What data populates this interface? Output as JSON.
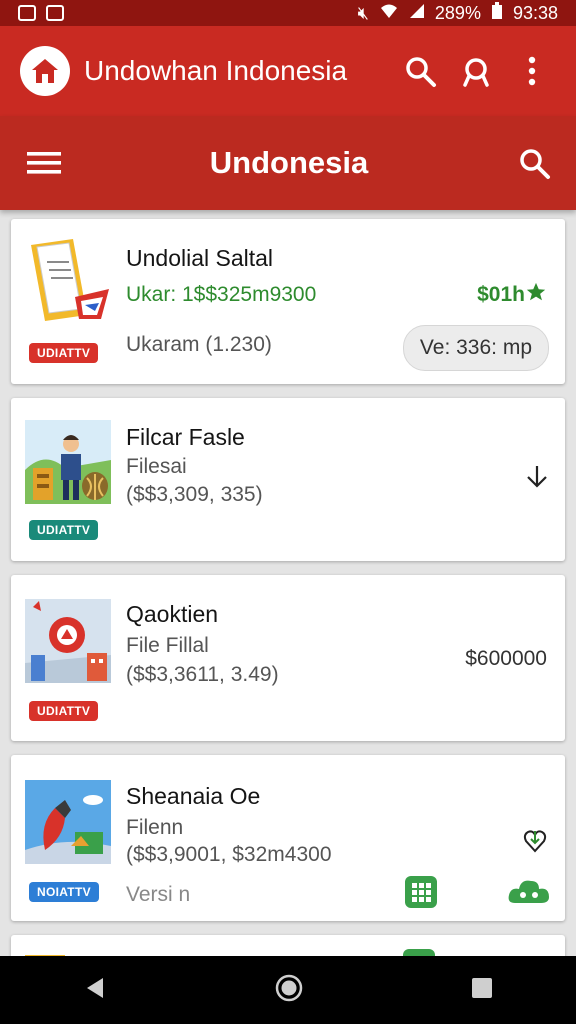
{
  "status_bar": {
    "battery": "289%",
    "time": "93:38"
  },
  "app_bar": {
    "title": "Undowhan Indonesia"
  },
  "sub_bar": {
    "title": "Undonesia"
  },
  "colors": {
    "primary": "#c92a22",
    "primary_dark": "#8f1510",
    "green": "#2e8b2e",
    "badge_red": "#d8322a",
    "badge_teal": "#1a8a7a",
    "badge_blue": "#2d7ed6"
  },
  "cards": [
    {
      "title": "Undolial Saltal",
      "line2": "Ukar: 1$$325m9300",
      "line3": "Ukaram (1.230)",
      "price": "$01h",
      "badge": "UDIATTV",
      "chip": "Ve: 336: mp",
      "icons": [
        "document-icon",
        "star-icon"
      ]
    },
    {
      "title": "Filcar Fasle",
      "line2": "Filesai",
      "line3": "($$3,309, 335)",
      "badge": "UDIATTV",
      "icons": [
        "person-icon",
        "download-arrow-icon"
      ]
    },
    {
      "title": "Qaoktien",
      "line2": "File Fillal",
      "line3": "($$3,3611, 3.49)",
      "price": "$600000",
      "badge": "UDIATTV",
      "icons": [
        "pin-map-icon"
      ]
    },
    {
      "title": "Sheanaia Oe",
      "line2": "Filenn",
      "line3": "($$3,9001, $32m4300",
      "line4": "Versi n",
      "badge": "NOIATTV",
      "icons": [
        "rocket-icon",
        "heart-download-icon",
        "grid-app-icon",
        "cloud-icon"
      ]
    }
  ]
}
